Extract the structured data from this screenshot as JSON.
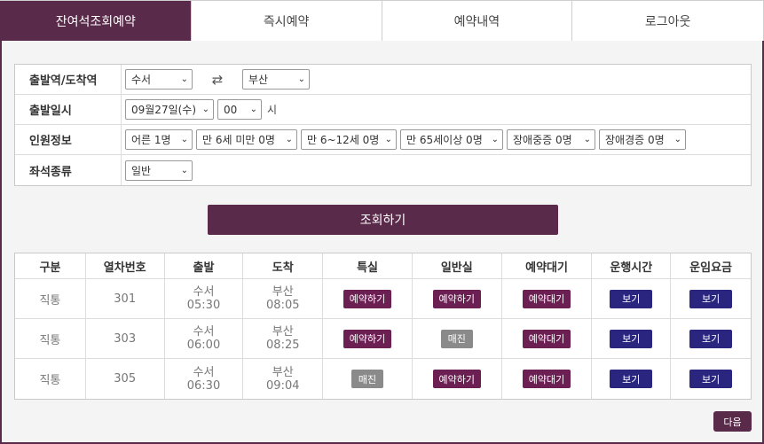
{
  "tabs": [
    {
      "label": "잔여석조회예약"
    },
    {
      "label": "즉시예약"
    },
    {
      "label": "예약내역"
    },
    {
      "label": "로그아웃"
    }
  ],
  "form": {
    "station_label": "출발역/도착역",
    "departure_station": "수서",
    "arrival_station": "부산",
    "date_label": "출발일시",
    "date_value": "09월27일(수)",
    "hour_value": "00",
    "hour_unit": "시",
    "passenger_label": "인원정보",
    "passengers": [
      "어른 1명",
      "만 6세 미만 0명",
      "만 6~12세 0명",
      "만 65세이상 0명",
      "장애중증 0명",
      "장애경증 0명"
    ],
    "seat_label": "좌석종류",
    "seat_value": "일반"
  },
  "search_label": "조회하기",
  "table": {
    "headers": [
      "구분",
      "열차번호",
      "출발",
      "도착",
      "특실",
      "일반실",
      "예약대기",
      "운행시간",
      "운임요금"
    ],
    "rows": [
      {
        "type": "직통",
        "train": "301",
        "dep_station": "수서",
        "dep_time": "05:30",
        "arr_station": "부산",
        "arr_time": "08:05",
        "special": "예약하기",
        "general": "예약하기",
        "waitlist": "예약대기",
        "time_btn": "보기",
        "fare_btn": "보기"
      },
      {
        "type": "직통",
        "train": "303",
        "dep_station": "수서",
        "dep_time": "06:00",
        "arr_station": "부산",
        "arr_time": "08:25",
        "special": "예약하기",
        "general": "매진",
        "waitlist": "예약대기",
        "time_btn": "보기",
        "fare_btn": "보기"
      },
      {
        "type": "직통",
        "train": "305",
        "dep_station": "수서",
        "dep_time": "06:30",
        "arr_station": "부산",
        "arr_time": "09:04",
        "special": "매진",
        "general": "예약하기",
        "waitlist": "예약대기",
        "time_btn": "보기",
        "fare_btn": "보기"
      }
    ]
  },
  "next_label": "다음",
  "icons": {
    "swap": "swap-arrows-icon",
    "dropdown": "chevron-down-icon"
  },
  "colors": {
    "accent": "#5a2a4a",
    "reserve": "#6b1f52",
    "view": "#2a2680",
    "soldout": "#8a8a8a"
  }
}
